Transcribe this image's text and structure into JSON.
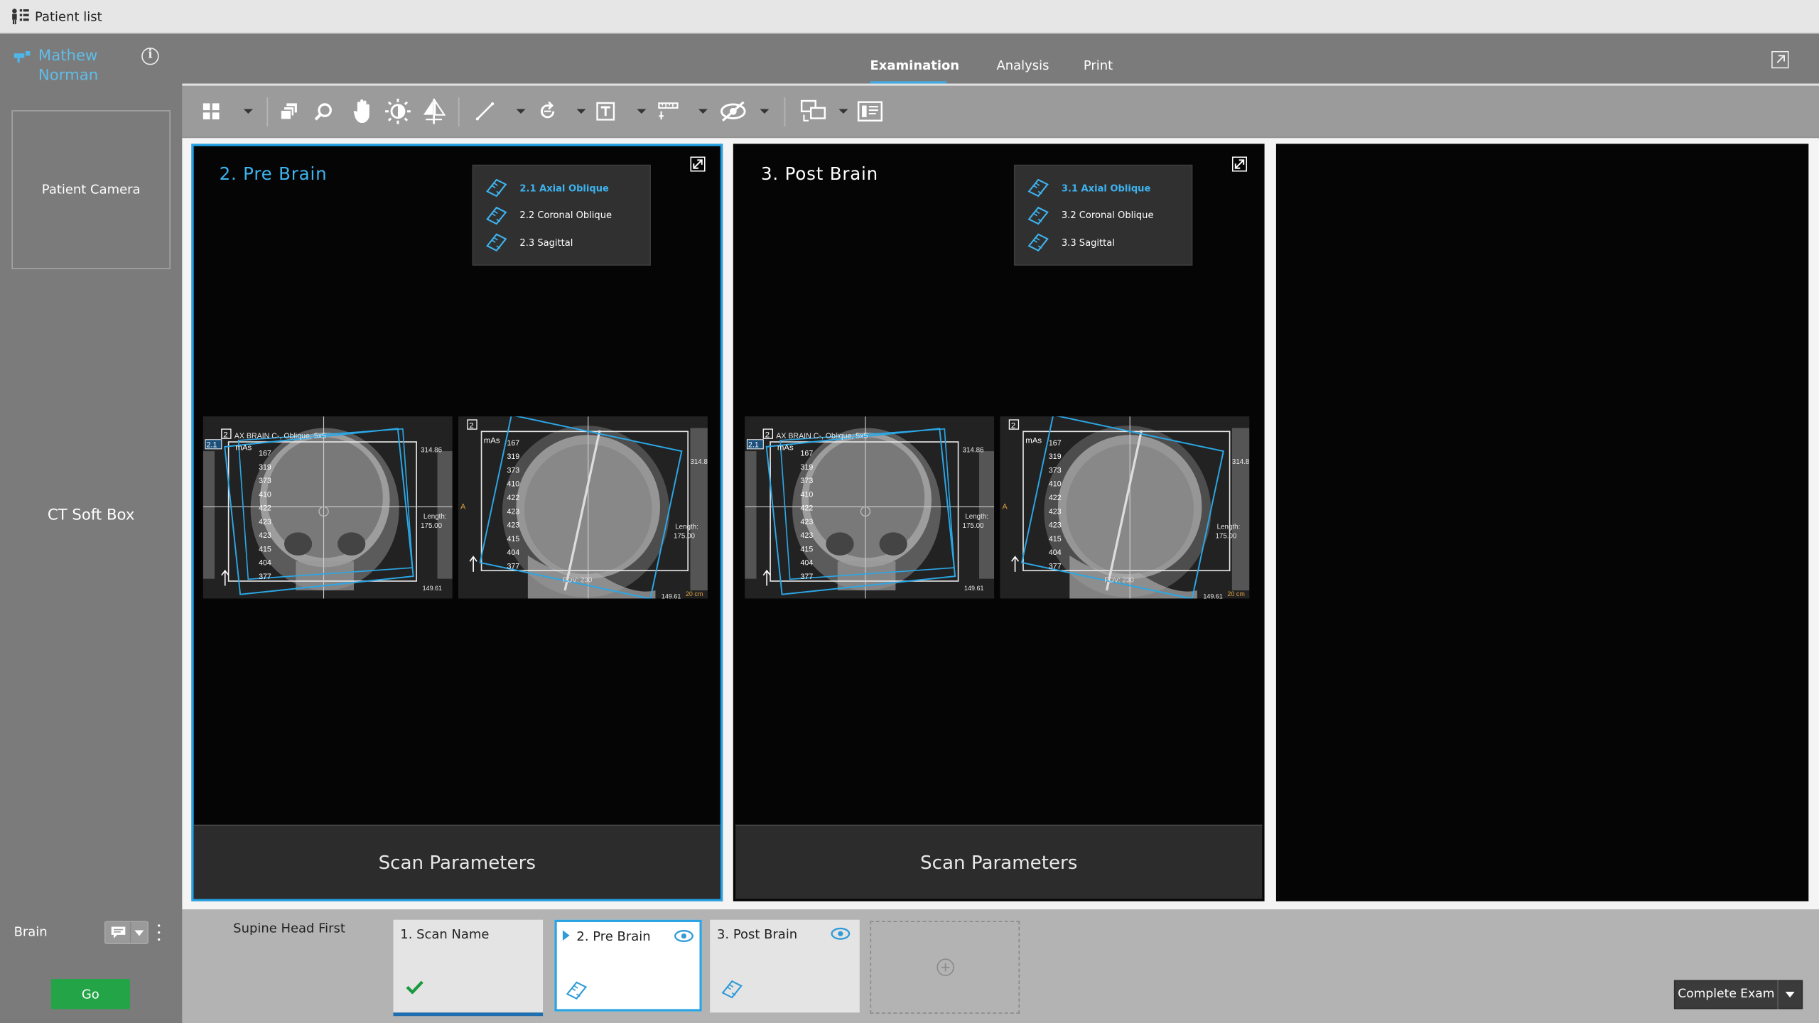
{
  "topbar": {
    "patient_list_label": "Patient list"
  },
  "patient": {
    "first_name": "Mathew",
    "last_name": "Norman"
  },
  "sidebar": {
    "camera_label": "Patient Camera",
    "protocol_title": "CT Soft Box",
    "exam_label": "Brain",
    "go_label": "Go"
  },
  "tabs": [
    {
      "label": "Examination",
      "active": true
    },
    {
      "label": "Analysis",
      "active": false
    },
    {
      "label": "Print",
      "active": false
    }
  ],
  "toolbar": {
    "tools": [
      "layout-grid-icon",
      "stack-icon",
      "zoom-icon",
      "pan-hand-icon",
      "window-level-icon",
      "flip-icon",
      "measure-line-icon",
      "rotate-icon",
      "text-annotation-icon",
      "ruler-icon",
      "hide-overlay-icon",
      "compare-icon",
      "info-panel-icon"
    ]
  },
  "viewports": [
    {
      "title": "2. Pre Brain",
      "active": true,
      "series": [
        {
          "label": "2.1 Axial Oblique",
          "selected": true
        },
        {
          "label": "2.2 Coronal Oblique",
          "selected": false
        },
        {
          "label": "2.3 Sagittal",
          "selected": false
        }
      ],
      "scan_params_label": "Scan Parameters",
      "coronal": {
        "badge_top": "2",
        "badge_series": "2.1",
        "header": "AX BRAIN C-, Oblique, 5x5",
        "mas_label": "mAs",
        "mas": [
          "167",
          "319",
          "373",
          "410",
          "422",
          "423",
          "423",
          "415",
          "404",
          "377"
        ],
        "right_top": "314.86",
        "length_label": "Length:",
        "length_value": "175.00",
        "right_bottom": "149.61"
      },
      "sagittal": {
        "badge_top": "2",
        "mas_label": "mAs",
        "mas": [
          "167",
          "319",
          "373",
          "410",
          "422",
          "423",
          "423",
          "415",
          "404",
          "377"
        ],
        "side_label": "A",
        "right_top": "314.8",
        "length_label": "Length:",
        "length_value": "175.00",
        "right_bottom": "149.61",
        "scale_label": "20 cm",
        "fov_label": "FOV: 230"
      }
    },
    {
      "title": "3. Post Brain",
      "active": false,
      "series": [
        {
          "label": "3.1 Axial Oblique",
          "selected": true
        },
        {
          "label": "3.2 Coronal Oblique",
          "selected": false
        },
        {
          "label": "3.3 Sagittal",
          "selected": false
        }
      ],
      "scan_params_label": "Scan Parameters",
      "coronal": {
        "badge_top": "2",
        "badge_series": "2.1",
        "header": "AX BRAIN C-, Oblique, 5x5",
        "mas_label": "mAs",
        "mas": [
          "167",
          "319",
          "373",
          "410",
          "422",
          "423",
          "423",
          "415",
          "404",
          "377"
        ],
        "right_top": "314.86",
        "length_label": "Length:",
        "length_value": "175.00",
        "right_bottom": "149.61"
      },
      "sagittal": {
        "badge_top": "2",
        "mas_label": "mAs",
        "mas": [
          "167",
          "319",
          "373",
          "410",
          "422",
          "423",
          "423",
          "415",
          "404",
          "377"
        ],
        "side_label": "A",
        "right_top": "314.8",
        "length_label": "Length:",
        "length_value": "175.00",
        "right_bottom": "149.61",
        "scale_label": "20 cm",
        "fov_label": "FOV: 230"
      }
    }
  ],
  "bottom": {
    "position_label": "Supine Head First",
    "scans": [
      {
        "label": "1. Scan Name",
        "status": "done"
      },
      {
        "label": "2. Pre Brain",
        "status": "selected"
      },
      {
        "label": "3. Post Brain",
        "status": "planned"
      }
    ],
    "complete_label": "Complete Exam"
  },
  "colors": {
    "accent": "#3db3ef",
    "go": "#22a447",
    "done": "#1a9a3e"
  }
}
